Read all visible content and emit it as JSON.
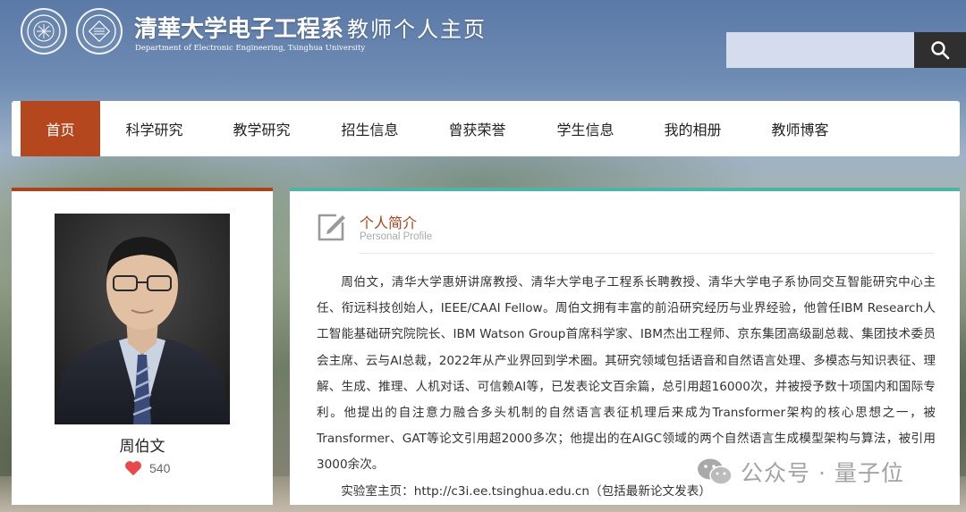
{
  "header": {
    "dept_name_cn": "清華大学电子工程系",
    "site_subtitle": "教师个人主页",
    "dept_name_en": "Department of Electronic Engineering, Tsinghua University",
    "search": {
      "value": "",
      "placeholder": ""
    },
    "search_icon": "search-icon"
  },
  "nav": {
    "items": [
      {
        "label": "首页",
        "active": true
      },
      {
        "label": "科学研究"
      },
      {
        "label": "教学研究"
      },
      {
        "label": "招生信息"
      },
      {
        "label": "曾获荣誉"
      },
      {
        "label": "学生信息"
      },
      {
        "label": "我的相册"
      },
      {
        "label": "教师博客"
      }
    ],
    "active_color": "#b5471f"
  },
  "profile": {
    "name": "周伯文",
    "likes": "540",
    "like_icon": "heart-icon",
    "accent_color": "#a8431c"
  },
  "intro": {
    "title": "个人简介",
    "subtitle": "Personal Profile",
    "icon": "edit-icon",
    "accent_color": "#4fb3a6",
    "paragraphs": [
      "周伯文，清华大学惠妍讲席教授、清华大学电子工程系长聘教授、清华大学电子系协同交互智能研究中心主任、衔远科技创始人，IEEE/CAAI Fellow。周伯文拥有丰富的前沿研究经历与业界经验，他曾任IBM Research人工智能基础研究院院长、IBM Watson Group首席科学家、IBM杰出工程师、京东集团高级副总裁、集团技术委员会主席、云与AI总裁，2022年从产业界回到学术圈。其研究领域包括语音和自然语言处理、多模态与知识表征、理解、生成、推理、人机对话、可信赖AI等，已发表论文百余篇，总引用超16000次，并被授予数十项国内和国际专利。他提出的自注意力融合多头机制的自然语言表征机理后来成为Transformer架构的核心思想之一，被Transformer、GAT等论文引用超2000多次；他提出的在AIGC领域的两个自然语言生成模型架构与算法，被引用3000余次。",
      "实验室主页：http://c3i.ee.tsinghua.edu.cn（包括最新论文发表）"
    ]
  },
  "watermark": {
    "text": "公众号 · 量子位",
    "icon": "wechat-icon"
  }
}
